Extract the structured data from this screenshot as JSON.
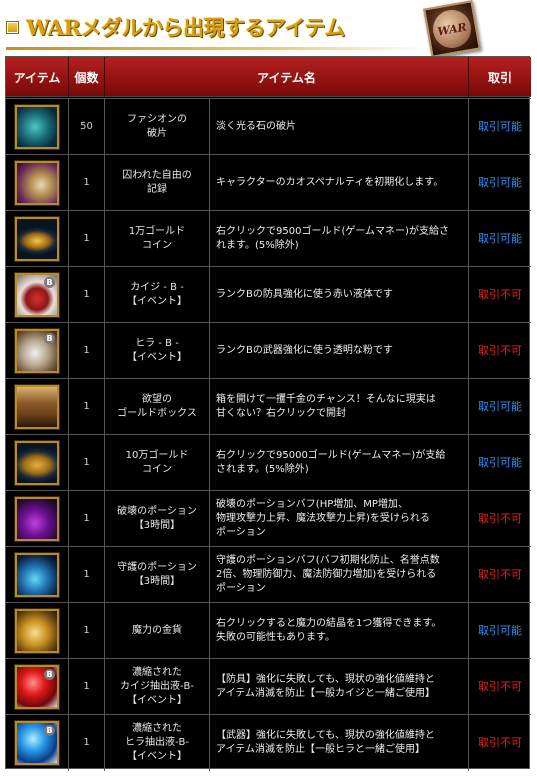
{
  "header": {
    "title": "WARメダルから出現するアイテム",
    "logo_text": "WAR"
  },
  "table": {
    "columns": [
      "アイテム",
      "個数",
      "アイテム名",
      "取引"
    ],
    "rows": [
      {
        "icon": "jade-shard-icon",
        "qty": "50",
        "name": "ファシオンの\n破片",
        "desc": "淡く光る石の破片",
        "trade": "取引可能",
        "trade_ok": true
      },
      {
        "icon": "scroll-icon",
        "qty": "1",
        "name": "囚われた自由の\n記録",
        "desc": "キャラクターのカオスペナルティを初期化します。",
        "trade": "取引可能",
        "trade_ok": true
      },
      {
        "icon": "gold-coin-icon",
        "qty": "1",
        "name": "1万ゴールド\nコイン",
        "desc": "右クリックで9500ゴールド(ゲームマネー)が支給さ\nれます。(5%除外)",
        "trade": "取引可能",
        "trade_ok": true
      },
      {
        "icon": "red-potion-icon",
        "qty": "1",
        "name": "カイジ - B -\n【イベント】",
        "desc": "ランクBの防具強化に使う赤い液体です",
        "trade": "取引不可",
        "trade_ok": false
      },
      {
        "icon": "powder-bag-icon",
        "qty": "1",
        "name": "ヒラ - B -\n【イベント】",
        "desc": "ランクBの武器強化に使う透明な粉です",
        "trade": "取引不可",
        "trade_ok": false
      },
      {
        "icon": "treasure-chest-icon",
        "qty": "1",
        "name": "欲望の\nゴールドボックス",
        "desc": "箱を開けて一攫千金のチャンス！そんなに現実は\n甘くない？右クリックで開封",
        "trade": "取引可能",
        "trade_ok": true
      },
      {
        "icon": "coin-stack-icon",
        "qty": "1",
        "name": "10万ゴールド\nコイン",
        "desc": "右クリックで95000ゴールド(ゲームマネー)が支給\nされます。(5%除外)",
        "trade": "取引可能",
        "trade_ok": true
      },
      {
        "icon": "purple-flask-icon",
        "qty": "1",
        "name": "破壊のポーション\n【3時間】",
        "desc": "破壊のポーションバフ(HP増加、MP増加、\n物理攻撃力上昇、魔法攻撃力上昇)を受けられる\nポーション",
        "trade": "取引不可",
        "trade_ok": false
      },
      {
        "icon": "blue-flask-icon",
        "qty": "1",
        "name": "守護のポーション\n【3時間】",
        "desc": "守護のポーションバフ(バフ初期化防止、名誉点数\n2倍、物理防御力、魔法防御力増加)を受けられる\nポーション",
        "trade": "取引不可",
        "trade_ok": false
      },
      {
        "icon": "gold-coins-icon",
        "qty": "1",
        "name": "魔力の金貨",
        "desc": "右クリックすると魔力の結晶を1つ獲得できます。\n失敗の可能性もあります。",
        "trade": "取引可能",
        "trade_ok": true
      },
      {
        "icon": "red-orb-icon",
        "qty": "1",
        "name": "濃縮された\nカイジ抽出液-B-\n【イベント】",
        "desc": "【防具】強化に失敗しても、現状の強化値維持と\nアイテム消滅を防止【一般カイジと一緒ご使用】",
        "trade": "取引不可",
        "trade_ok": false
      },
      {
        "icon": "blue-orb-icon",
        "qty": "1",
        "name": "濃縮された\nヒラ抽出液-B-\n【イベント】",
        "desc": "【武器】強化に失敗しても、現状の強化値維持と\nアイテム消滅を防止【一般ヒラと一緒ご使用】",
        "trade": "取引不可",
        "trade_ok": false
      }
    ]
  },
  "colors": {
    "trade_ok": "#2f8ff0",
    "trade_ng": "#e02020",
    "header_gold": "#d8a010",
    "thead_red": "#9a1010"
  }
}
